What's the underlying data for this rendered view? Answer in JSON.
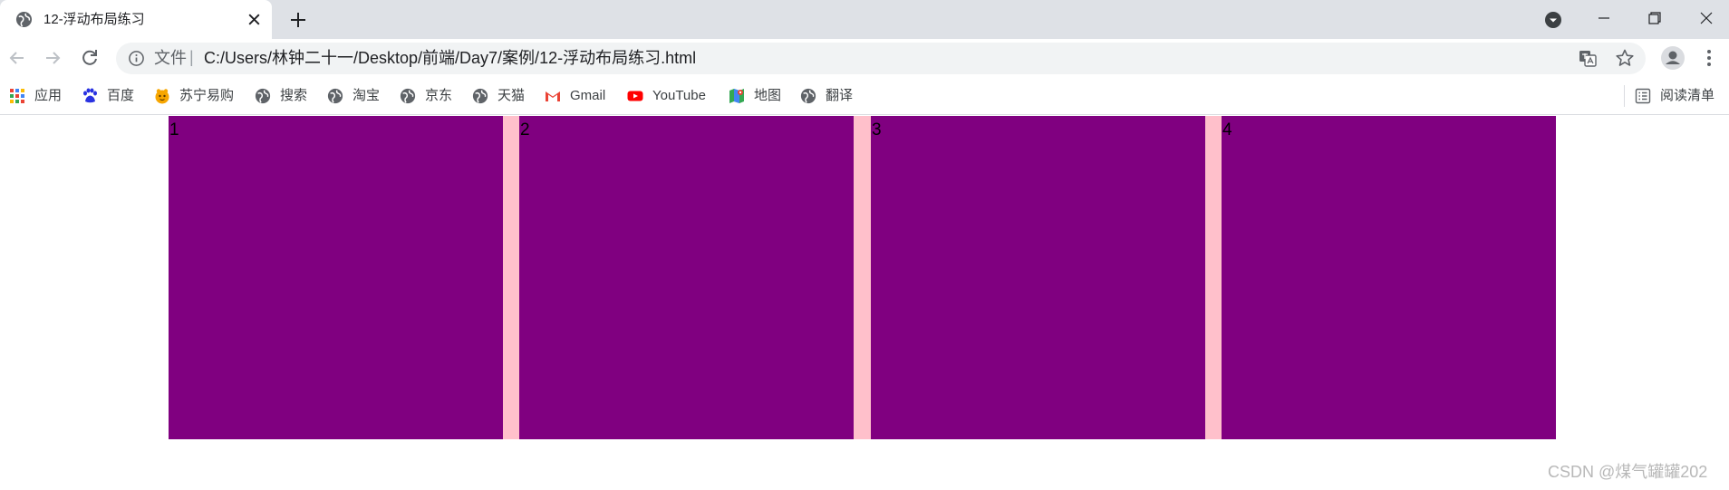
{
  "browser": {
    "tab": {
      "title": "12-浮动布局练习",
      "favicon": "globe-icon"
    },
    "new_tab_icon": "plus-icon",
    "window_controls": [
      "minimize-icon",
      "restore-icon",
      "close-icon"
    ],
    "address_bar": {
      "security_label": "文件",
      "url": "C:/Users/林钟二十一/Desktop/前端/Day7/案例/12-浮动布局练习.html"
    },
    "bookmarks": [
      {
        "label": "应用",
        "icon": "apps-grid-icon"
      },
      {
        "label": "百度",
        "icon": "baidu-paw-icon"
      },
      {
        "label": "苏宁易购",
        "icon": "suning-icon"
      },
      {
        "label": "搜索",
        "icon": "globe-icon"
      },
      {
        "label": "淘宝",
        "icon": "globe-icon"
      },
      {
        "label": "京东",
        "icon": "globe-icon"
      },
      {
        "label": "天猫",
        "icon": "globe-icon"
      },
      {
        "label": "Gmail",
        "icon": "gmail-icon"
      },
      {
        "label": "YouTube",
        "icon": "youtube-icon"
      },
      {
        "label": "地图",
        "icon": "maps-icon"
      },
      {
        "label": "翻译",
        "icon": "globe-icon"
      }
    ],
    "reading_list": {
      "label": "阅读清单",
      "icon": "reading-list-icon"
    }
  },
  "page": {
    "boxes": [
      "1",
      "2",
      "3",
      "4"
    ],
    "colors": {
      "box": "#800080",
      "container": "#ffc0cb"
    }
  },
  "watermark": "CSDN @煤气罐罐202",
  "colors": {
    "tabstrip": "#dee1e6",
    "omnibox": "#f1f3f4",
    "icon": "#5f6368"
  }
}
